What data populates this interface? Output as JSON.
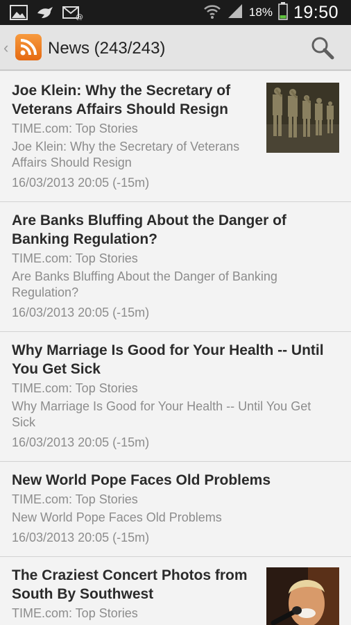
{
  "status_bar": {
    "icons": [
      "gallery-icon",
      "bird-icon",
      "mail-at-icon",
      "wifi-icon",
      "signal-icon",
      "battery-icon"
    ],
    "battery": "18%",
    "time": "19:50"
  },
  "action_bar": {
    "title": "News (243/243)",
    "logo_icon": "rss-icon",
    "back_icon": "chevron-left-icon",
    "search_icon": "search-icon",
    "colors": {
      "rss": "#f08a24",
      "bar": "#e4e4e4"
    }
  },
  "articles": [
    {
      "title": "Joe Klein: Why the Secretary of Veterans Affairs Should Resign",
      "source": "TIME.com: Top Stories",
      "description": "Joe Klein: Why the Secretary of Veterans Affairs Should Resign",
      "date": "16/03/2013 20:05 (-15m)",
      "thumbnail": "soldiers-saluting"
    },
    {
      "title": "Are Banks Bluffing About the Danger of Banking Regulation?",
      "source": "TIME.com: Top Stories",
      "description": "Are Banks Bluffing About the Danger of Banking Regulation?",
      "date": "16/03/2013 20:05 (-15m)"
    },
    {
      "title": "Why Marriage Is Good for Your Health -- Until You Get Sick",
      "source": "TIME.com: Top Stories",
      "description": "Why Marriage Is Good for Your Health -- Until You Get Sick",
      "date": "16/03/2013 20:05 (-15m)"
    },
    {
      "title": "New World Pope Faces Old Problems",
      "source": "TIME.com: Top Stories",
      "description": "New World Pope Faces Old Problems",
      "date": "16/03/2013 20:05 (-15m)"
    },
    {
      "title": "The Craziest Concert Photos from South By Southwest",
      "source": "TIME.com: Top Stories",
      "thumbnail": "singer-with-microphone"
    }
  ]
}
